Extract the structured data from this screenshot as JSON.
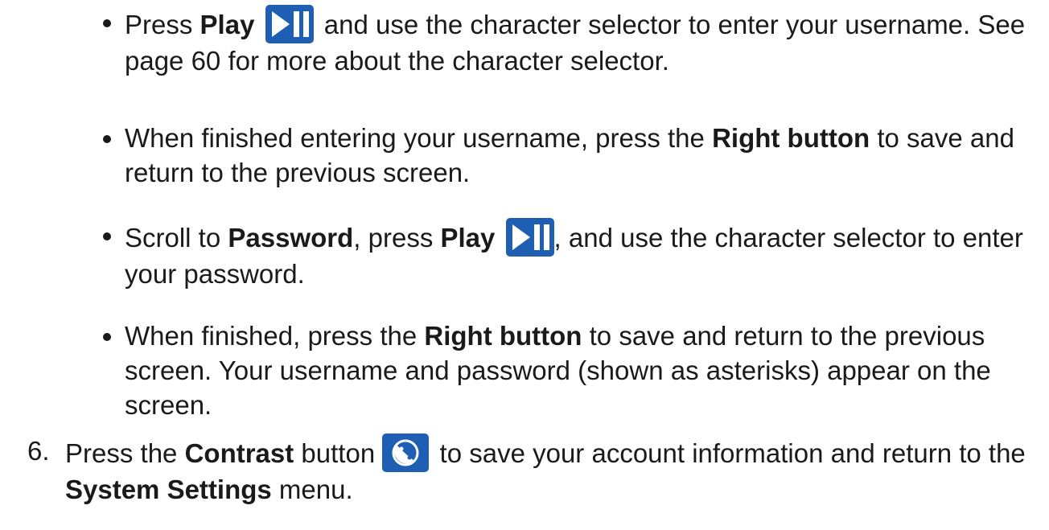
{
  "bullets": [
    {
      "pre": "Press ",
      "bold1": "Play",
      "post": " and use the character selector to enter your username. See page 60 for more about the character selector."
    },
    {
      "pre": "When finished entering your username, press the ",
      "bold1": "Right button",
      "post": " to save and return to the previous screen."
    },
    {
      "pre": "Scroll to ",
      "bold1": "Password",
      "mid": ", press ",
      "bold2": "Play",
      "post": ", and use the character selector to enter your password."
    },
    {
      "pre": "When finished, press the ",
      "bold1": "Right button",
      "post": " to save and return to the previous screen. Your username and password (shown as asterisks) appear on the screen."
    }
  ],
  "step6": {
    "number": "6.",
    "pre": "Press the ",
    "bold1": "Contrast",
    "mid": " button ",
    "post": " to save your account information and return to the ",
    "bold2": "System Settings",
    "end": " menu."
  },
  "icons": {
    "play": "play-pause-icon",
    "contrast": "contrast-icon"
  },
  "colors": {
    "icon_blue": "#1e5fb4"
  }
}
